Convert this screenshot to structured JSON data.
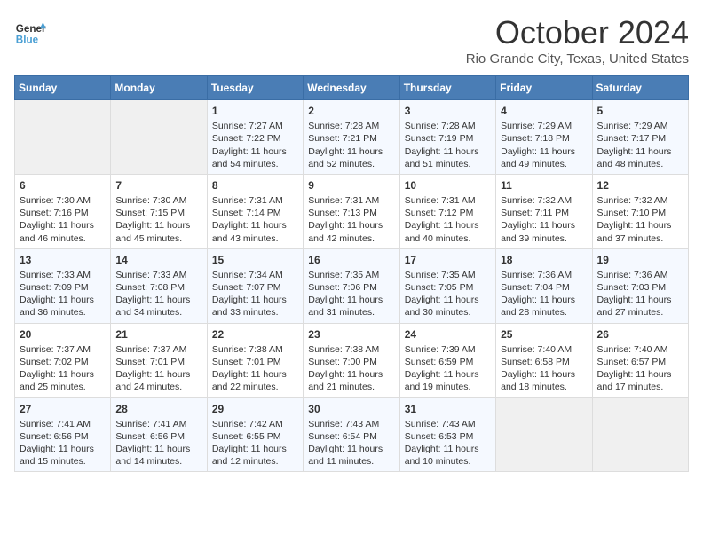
{
  "header": {
    "logo_line1": "General",
    "logo_line2": "Blue",
    "title": "October 2024",
    "subtitle": "Rio Grande City, Texas, United States"
  },
  "weekdays": [
    "Sunday",
    "Monday",
    "Tuesday",
    "Wednesday",
    "Thursday",
    "Friday",
    "Saturday"
  ],
  "weeks": [
    [
      {
        "day": "",
        "info": ""
      },
      {
        "day": "",
        "info": ""
      },
      {
        "day": "1",
        "info": "Sunrise: 7:27 AM\nSunset: 7:22 PM\nDaylight: 11 hours and 54 minutes."
      },
      {
        "day": "2",
        "info": "Sunrise: 7:28 AM\nSunset: 7:21 PM\nDaylight: 11 hours and 52 minutes."
      },
      {
        "day": "3",
        "info": "Sunrise: 7:28 AM\nSunset: 7:19 PM\nDaylight: 11 hours and 51 minutes."
      },
      {
        "day": "4",
        "info": "Sunrise: 7:29 AM\nSunset: 7:18 PM\nDaylight: 11 hours and 49 minutes."
      },
      {
        "day": "5",
        "info": "Sunrise: 7:29 AM\nSunset: 7:17 PM\nDaylight: 11 hours and 48 minutes."
      }
    ],
    [
      {
        "day": "6",
        "info": "Sunrise: 7:30 AM\nSunset: 7:16 PM\nDaylight: 11 hours and 46 minutes."
      },
      {
        "day": "7",
        "info": "Sunrise: 7:30 AM\nSunset: 7:15 PM\nDaylight: 11 hours and 45 minutes."
      },
      {
        "day": "8",
        "info": "Sunrise: 7:31 AM\nSunset: 7:14 PM\nDaylight: 11 hours and 43 minutes."
      },
      {
        "day": "9",
        "info": "Sunrise: 7:31 AM\nSunset: 7:13 PM\nDaylight: 11 hours and 42 minutes."
      },
      {
        "day": "10",
        "info": "Sunrise: 7:31 AM\nSunset: 7:12 PM\nDaylight: 11 hours and 40 minutes."
      },
      {
        "day": "11",
        "info": "Sunrise: 7:32 AM\nSunset: 7:11 PM\nDaylight: 11 hours and 39 minutes."
      },
      {
        "day": "12",
        "info": "Sunrise: 7:32 AM\nSunset: 7:10 PM\nDaylight: 11 hours and 37 minutes."
      }
    ],
    [
      {
        "day": "13",
        "info": "Sunrise: 7:33 AM\nSunset: 7:09 PM\nDaylight: 11 hours and 36 minutes."
      },
      {
        "day": "14",
        "info": "Sunrise: 7:33 AM\nSunset: 7:08 PM\nDaylight: 11 hours and 34 minutes."
      },
      {
        "day": "15",
        "info": "Sunrise: 7:34 AM\nSunset: 7:07 PM\nDaylight: 11 hours and 33 minutes."
      },
      {
        "day": "16",
        "info": "Sunrise: 7:35 AM\nSunset: 7:06 PM\nDaylight: 11 hours and 31 minutes."
      },
      {
        "day": "17",
        "info": "Sunrise: 7:35 AM\nSunset: 7:05 PM\nDaylight: 11 hours and 30 minutes."
      },
      {
        "day": "18",
        "info": "Sunrise: 7:36 AM\nSunset: 7:04 PM\nDaylight: 11 hours and 28 minutes."
      },
      {
        "day": "19",
        "info": "Sunrise: 7:36 AM\nSunset: 7:03 PM\nDaylight: 11 hours and 27 minutes."
      }
    ],
    [
      {
        "day": "20",
        "info": "Sunrise: 7:37 AM\nSunset: 7:02 PM\nDaylight: 11 hours and 25 minutes."
      },
      {
        "day": "21",
        "info": "Sunrise: 7:37 AM\nSunset: 7:01 PM\nDaylight: 11 hours and 24 minutes."
      },
      {
        "day": "22",
        "info": "Sunrise: 7:38 AM\nSunset: 7:01 PM\nDaylight: 11 hours and 22 minutes."
      },
      {
        "day": "23",
        "info": "Sunrise: 7:38 AM\nSunset: 7:00 PM\nDaylight: 11 hours and 21 minutes."
      },
      {
        "day": "24",
        "info": "Sunrise: 7:39 AM\nSunset: 6:59 PM\nDaylight: 11 hours and 19 minutes."
      },
      {
        "day": "25",
        "info": "Sunrise: 7:40 AM\nSunset: 6:58 PM\nDaylight: 11 hours and 18 minutes."
      },
      {
        "day": "26",
        "info": "Sunrise: 7:40 AM\nSunset: 6:57 PM\nDaylight: 11 hours and 17 minutes."
      }
    ],
    [
      {
        "day": "27",
        "info": "Sunrise: 7:41 AM\nSunset: 6:56 PM\nDaylight: 11 hours and 15 minutes."
      },
      {
        "day": "28",
        "info": "Sunrise: 7:41 AM\nSunset: 6:56 PM\nDaylight: 11 hours and 14 minutes."
      },
      {
        "day": "29",
        "info": "Sunrise: 7:42 AM\nSunset: 6:55 PM\nDaylight: 11 hours and 12 minutes."
      },
      {
        "day": "30",
        "info": "Sunrise: 7:43 AM\nSunset: 6:54 PM\nDaylight: 11 hours and 11 minutes."
      },
      {
        "day": "31",
        "info": "Sunrise: 7:43 AM\nSunset: 6:53 PM\nDaylight: 11 hours and 10 minutes."
      },
      {
        "day": "",
        "info": ""
      },
      {
        "day": "",
        "info": ""
      }
    ]
  ]
}
